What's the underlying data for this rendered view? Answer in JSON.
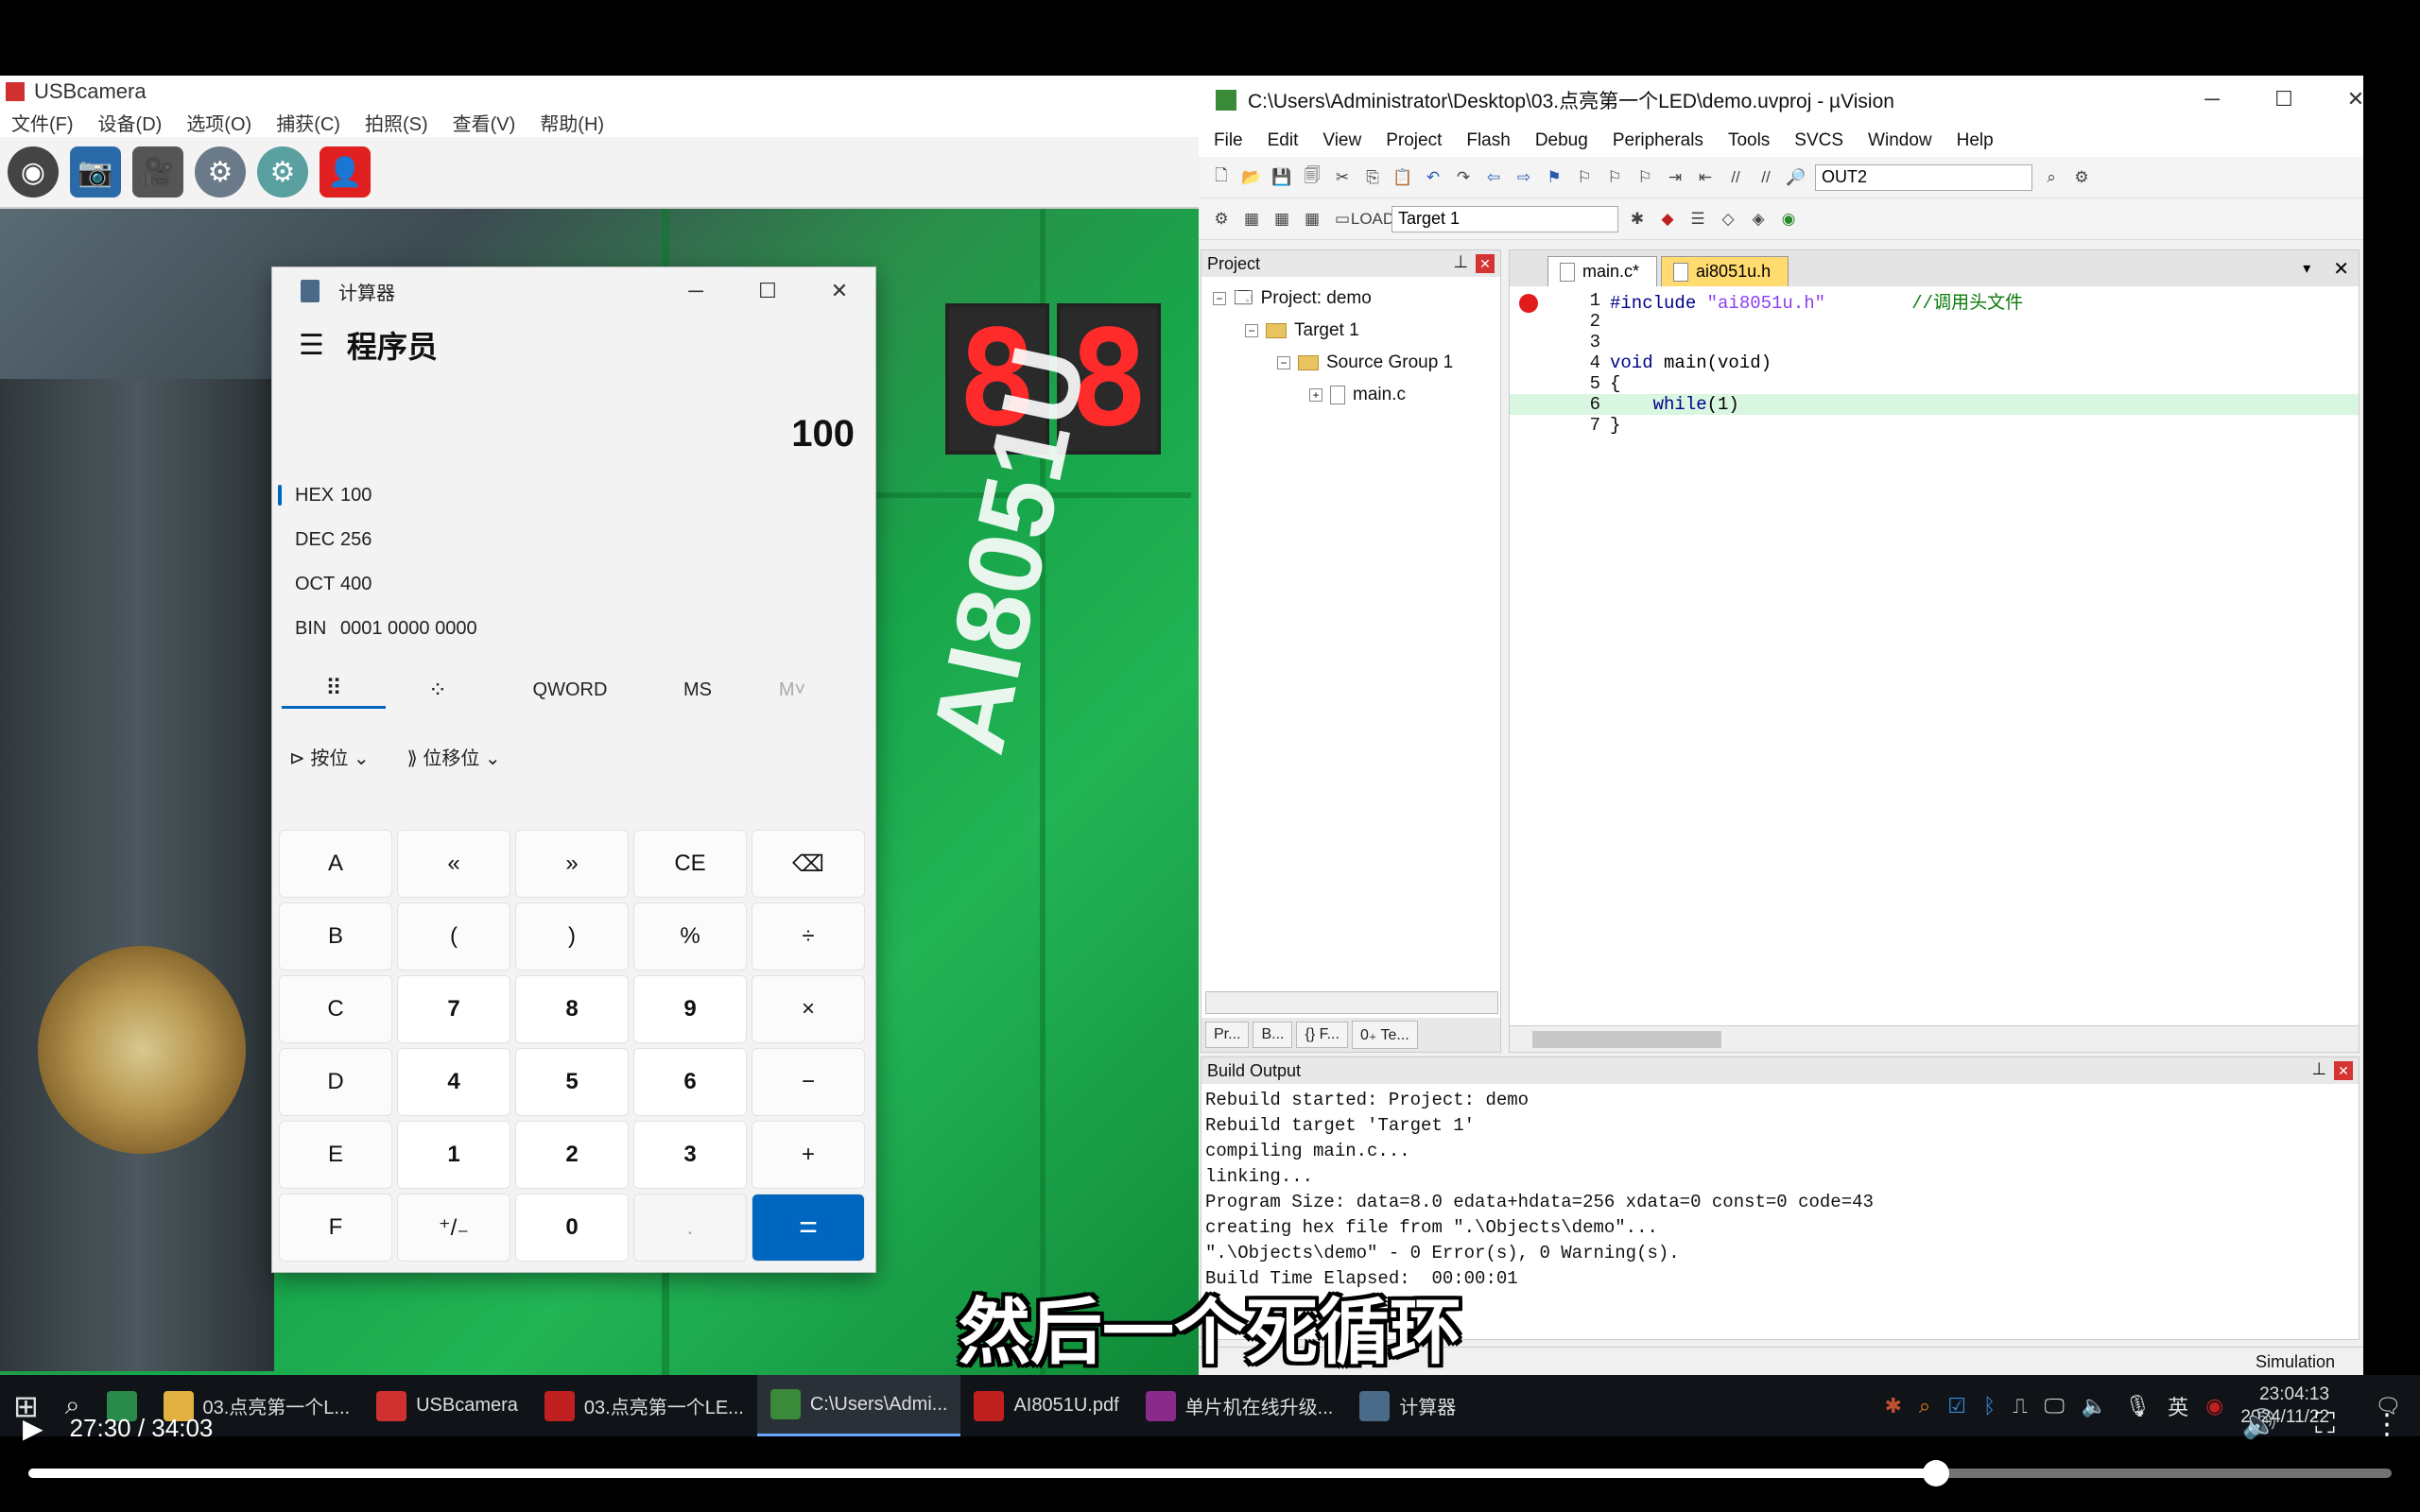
{
  "usbcam": {
    "title": "USBcamera",
    "menu": [
      "文件(F)",
      "设备(D)",
      "选项(O)",
      "捕获(C)",
      "拍照(S)",
      "查看(V)",
      "帮助(H)"
    ]
  },
  "calculator": {
    "title": "计算器",
    "mode": "程序员",
    "display": "100",
    "radix": [
      {
        "label": "HEX",
        "value": "100",
        "active": true
      },
      {
        "label": "DEC",
        "value": "256",
        "active": false
      },
      {
        "label": "OCT",
        "value": "400",
        "active": false
      },
      {
        "label": "BIN",
        "value": "0001 0000 0000",
        "active": false
      }
    ],
    "word_size": "QWORD",
    "ms": "MS",
    "mr": "M˅",
    "bitwise": "按位",
    "bitshift": "位移位",
    "keys": [
      [
        "A",
        "«",
        "»",
        "CE",
        "⌫"
      ],
      [
        "B",
        "(",
        ")",
        "%",
        "÷"
      ],
      [
        "C",
        "7",
        "8",
        "9",
        "×"
      ],
      [
        "D",
        "4",
        "5",
        "6",
        "−"
      ],
      [
        "E",
        "1",
        "2",
        "3",
        "+"
      ],
      [
        "F",
        "⁺/₋",
        "0",
        ".",
        "="
      ]
    ]
  },
  "uvision": {
    "title": "C:\\Users\\Administrator\\Desktop\\03.点亮第一个LED\\demo.uvproj - µVision",
    "menu": [
      "File",
      "Edit",
      "View",
      "Project",
      "Flash",
      "Debug",
      "Peripherals",
      "Tools",
      "SVCS",
      "Window",
      "Help"
    ],
    "toolbar_combo": "OUT2",
    "target_combo": "Target 1",
    "project_pane_title": "Project",
    "tree": {
      "project": "Project: demo",
      "target": "Target 1",
      "group": "Source Group 1",
      "file": "main.c"
    },
    "project_tabs": [
      "Pr...",
      "B...",
      "{} F...",
      "0₊ Te..."
    ],
    "editor_tabs": [
      "main.c*",
      "ai8051u.h"
    ],
    "code": [
      {
        "n": "1",
        "pre": "",
        "kw": "#include",
        "str": " \"ai8051u.h\"",
        "cmt": "        //调用头文件"
      },
      {
        "n": "2",
        "pre": "",
        "kw": "",
        "str": "",
        "cmt": ""
      },
      {
        "n": "3",
        "pre": "",
        "kw": "",
        "str": "",
        "cmt": ""
      },
      {
        "n": "4",
        "pre": "",
        "kw": "void",
        "str": " main(void)",
        "cmt": ""
      },
      {
        "n": "5",
        "pre": "{",
        "kw": "",
        "str": "",
        "cmt": ""
      },
      {
        "n": "6",
        "pre": "    ",
        "kw": "while",
        "str": "(1)",
        "cmt": ""
      },
      {
        "n": "7",
        "pre": "}",
        "kw": "",
        "str": "",
        "cmt": ""
      }
    ],
    "build_title": "Build Output",
    "build_lines": [
      "Rebuild started: Project: demo",
      "Rebuild target 'Target 1'",
      "compiling main.c...",
      "linking...",
      "Program Size: data=8.0 edata+hdata=256 xdata=0 const=0 code=43",
      "creating hex file from \".\\Objects\\demo\"...",
      "\".\\Objects\\demo\" - 0 Error(s), 0 Warning(s).",
      "Build Time Elapsed:  00:00:01"
    ],
    "status": "Simulation"
  },
  "subtitle": "然后一个死循环",
  "taskbar": {
    "items": [
      {
        "label": "03.点亮第一个L...",
        "color": "#e0b040"
      },
      {
        "label": "USBcamera",
        "color": "#d03030"
      },
      {
        "label": "03.点亮第一个LE...",
        "color": "#c02020"
      },
      {
        "label": "C:\\Users\\Admi...",
        "color": "#3a8a3a"
      },
      {
        "label": "AI8051U.pdf",
        "color": "#c02020"
      },
      {
        "label": "单片机在线升级...",
        "color": "#8a2a8a"
      },
      {
        "label": "计算器",
        "color": "#4a6a8a"
      }
    ],
    "active_index": 3,
    "lang": "英",
    "time": "23:04:13",
    "date": "2024/11/22"
  },
  "player": {
    "current": "27:30",
    "total": "34:03",
    "progress_fraction": 0.807
  }
}
